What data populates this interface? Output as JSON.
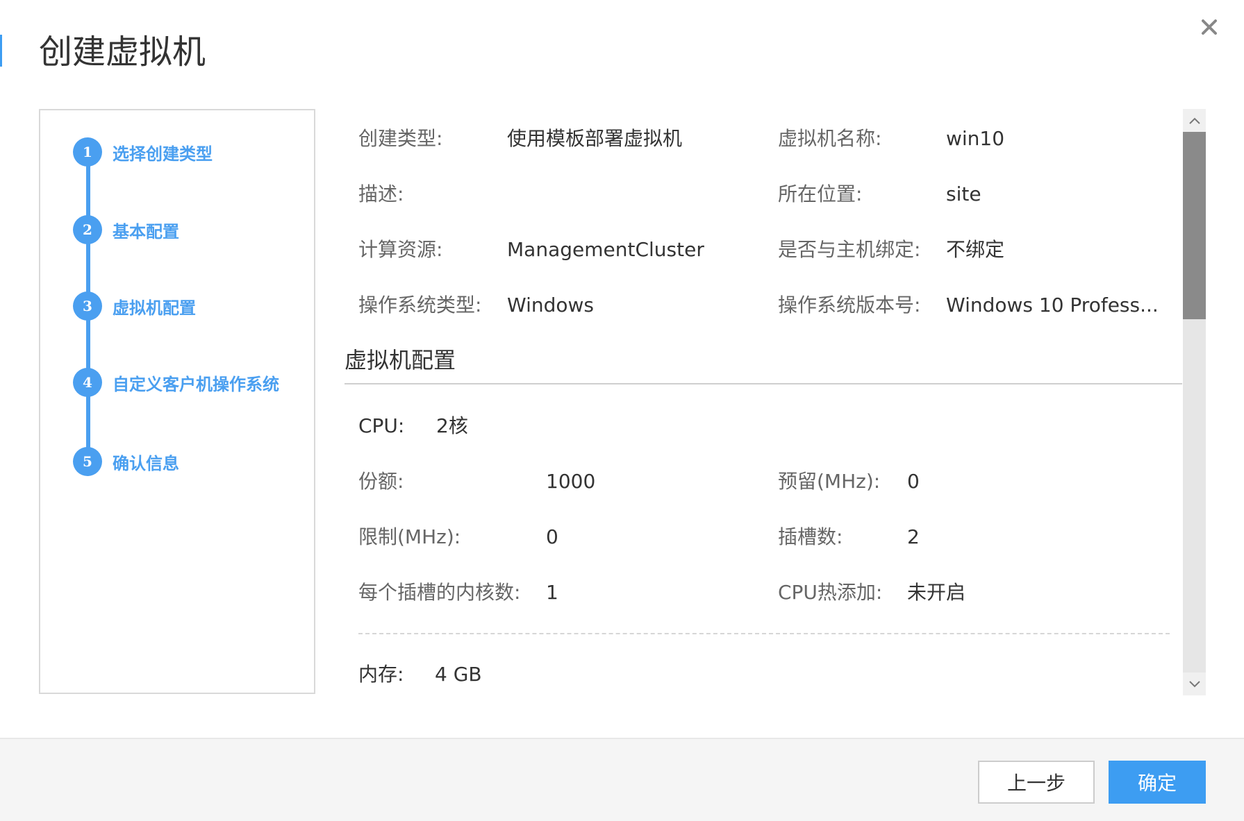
{
  "dialog": {
    "title": "创建虚拟机"
  },
  "steps": [
    {
      "num": "1",
      "label": "选择创建类型"
    },
    {
      "num": "2",
      "label": "基本配置"
    },
    {
      "num": "3",
      "label": "虚拟机配置"
    },
    {
      "num": "4",
      "label": "自定义客户机操作系统"
    },
    {
      "num": "5",
      "label": "确认信息"
    }
  ],
  "summary": {
    "create_type": {
      "label": "创建类型:",
      "value": "使用模板部署虚拟机"
    },
    "vm_name": {
      "label": "虚拟机名称:",
      "value": "win10"
    },
    "description": {
      "label": "描述:",
      "value": ""
    },
    "location": {
      "label": "所在位置:",
      "value": "site"
    },
    "compute": {
      "label": "计算资源:",
      "value": "ManagementCluster"
    },
    "host_bind": {
      "label": "是否与主机绑定:",
      "value": "不绑定"
    },
    "os_type": {
      "label": "操作系统类型:",
      "value": "Windows"
    },
    "os_version": {
      "label": "操作系统版本号:",
      "value": "Windows 10 Profess..."
    }
  },
  "vm_config": {
    "title": "虚拟机配置",
    "cpu": {
      "label": "CPU:",
      "value": "2核"
    },
    "shares": {
      "label": "份额:",
      "value": "1000"
    },
    "reserve": {
      "label": "预留(MHz):",
      "value": "0"
    },
    "limit": {
      "label": "限制(MHz):",
      "value": "0"
    },
    "sockets": {
      "label": "插槽数:",
      "value": "2"
    },
    "cores_per_socket": {
      "label": "每个插槽的内核数:",
      "value": "1"
    },
    "cpu_hotplug": {
      "label": "CPU热添加:",
      "value": "未开启"
    },
    "memory": {
      "label": "内存:",
      "value": "4 GB"
    }
  },
  "footer": {
    "prev_label": "上一步",
    "ok_label": "确定"
  },
  "colors": {
    "accent": "#3d9df2",
    "step": "#4a9ff0"
  }
}
